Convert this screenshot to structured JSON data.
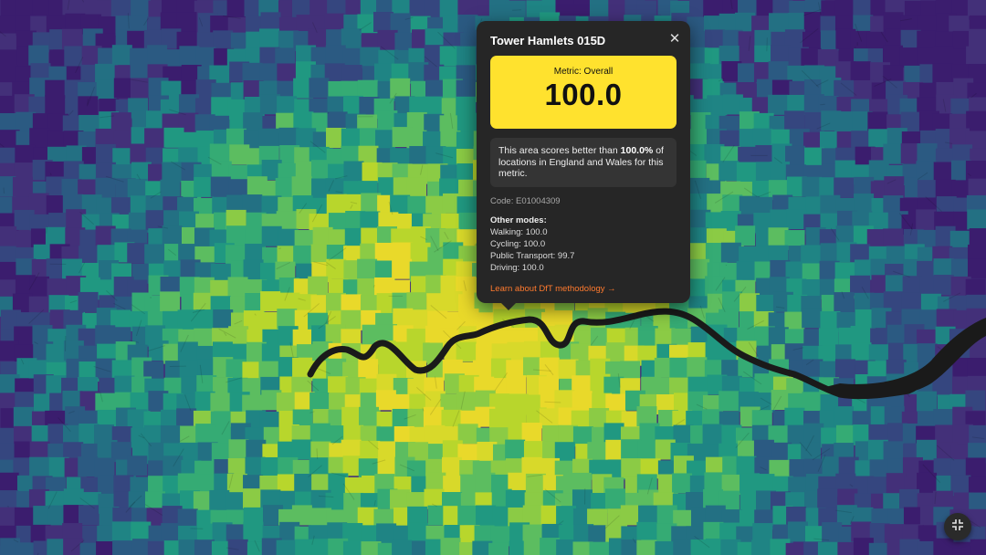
{
  "map": {
    "palette": [
      "#3b1d6e",
      "#433079",
      "#35467f",
      "#2b5a82",
      "#237083",
      "#1f8484",
      "#209881",
      "#35ab74",
      "#5cbd60",
      "#8bcb45",
      "#b8d62c",
      "#d8d92a",
      "#e9d92a"
    ],
    "river_color": "#1a1a1a"
  },
  "popup": {
    "title": "Tower Hamlets 015D",
    "close_symbol": "✕",
    "metric_label": "Metric: Overall",
    "score": "100.0",
    "score_color": "#ffe22e",
    "percentile_prefix": "This area scores better than",
    "percentile_value": "100.0%",
    "percentile_suffix": "of locations in England and Wales for this metric.",
    "code": "Code: E01004309",
    "other_modes_heading": "Other modes:",
    "modes": [
      {
        "label": "Walking: 100.0"
      },
      {
        "label": "Cycling: 100.0"
      },
      {
        "label": "Public Transport: 99.7"
      },
      {
        "label": "Driving: 100.0"
      }
    ],
    "learn_link": "Learn about DfT methodology →",
    "link_color": "#ff7a2e"
  },
  "controls": {
    "fullscreen_icon": "exit-fullscreen-icon"
  }
}
